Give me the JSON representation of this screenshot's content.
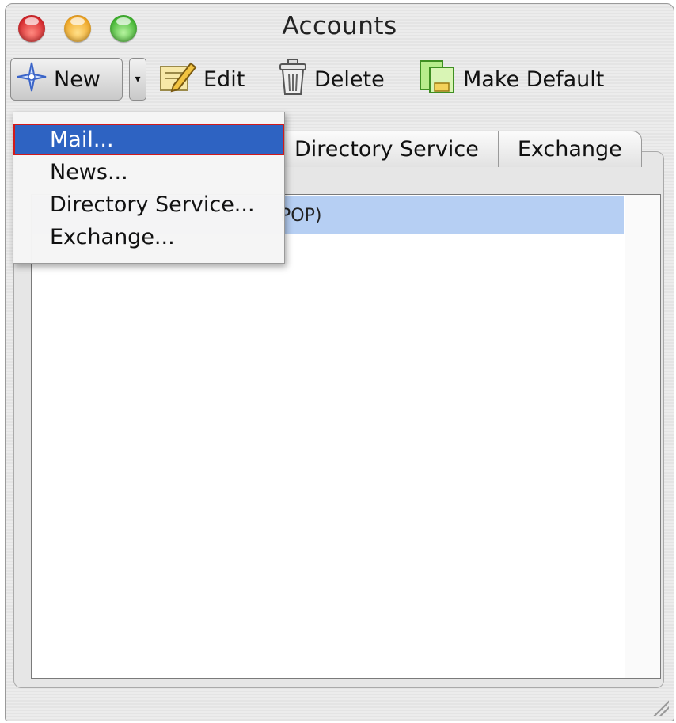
{
  "window": {
    "title": "Accounts"
  },
  "toolbar": {
    "new_label": "New",
    "edit_label": "Edit",
    "delete_label": "Delete",
    "make_default_label": "Make Default"
  },
  "tabs": [
    {
      "label": "Directory Service"
    },
    {
      "label": "Exchange"
    }
  ],
  "accounts_list": {
    "rows": [
      {
        "label": "POP)",
        "selected": true
      }
    ]
  },
  "new_menu": {
    "items": [
      {
        "label": "Mail...",
        "highlighted": true
      },
      {
        "label": "News..."
      },
      {
        "label": "Directory Service..."
      },
      {
        "label": "Exchange..."
      }
    ]
  },
  "colors": {
    "menu_highlight": "#2e63c2",
    "menu_highlight_outline": "#d21a1a",
    "list_selection": "#b6cff3"
  },
  "icons": {
    "new": "sparkle-star-icon",
    "edit": "pencil-pad-icon",
    "delete": "trash-can-icon",
    "make_default": "green-document-icon"
  }
}
